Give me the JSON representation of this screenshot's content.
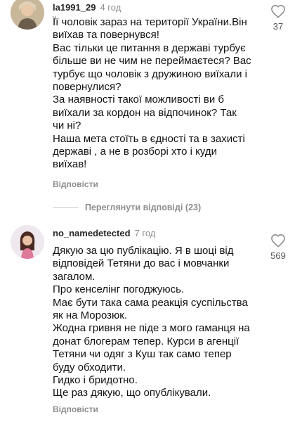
{
  "comments": [
    {
      "username": "la1991_29",
      "time": "4 год",
      "lines": [
        "Її чоловік зараз на території України.Він",
        "виїхав та повернувся!",
        "Вас тільки це питання в державі турбує",
        "більше ви не чим не переймаєтеся? Вас",
        "турбує що чоловік з дружиною виїхали і",
        "повернулися?",
        "За наявності такої можливості ви б",
        "виїхали за кордон на відпочинок? Так",
        "чи ні?",
        "Наша мета стоїть в єдності та в захисті",
        "державі , а не в розборі хто і куди",
        "виїхав!"
      ],
      "reply_label": "Відповісти",
      "likes": "37",
      "icon": "heart-outline-icon"
    },
    {
      "username": "no_namedetected",
      "time": "7 год",
      "lines": [
        "Дякую за цю публікацію. Я в шоці від",
        "відповідей Тетяни до вас і мовчанки",
        "загалом.",
        "Про кенселінг погоджуюсь.",
        "Має бути така сама реакція суспільства",
        "як на Морозюк.",
        "Жодна гривня не піде з мого гаманця на",
        "донат блогерам тепер. Курси в агенції",
        "Тетяни чи одяг з Куш так само тепер",
        "буду обходити.",
        "Гидко і бридотно.",
        "Ще раз дякую, що опублікували."
      ],
      "reply_label": "Відповісти",
      "likes": "569",
      "icon": "heart-outline-icon"
    }
  ],
  "view_replies_label": "Переглянути відповіді (23)",
  "colors": {
    "muted": "#8e8e8e",
    "text": "#111111",
    "username": "#262626"
  }
}
